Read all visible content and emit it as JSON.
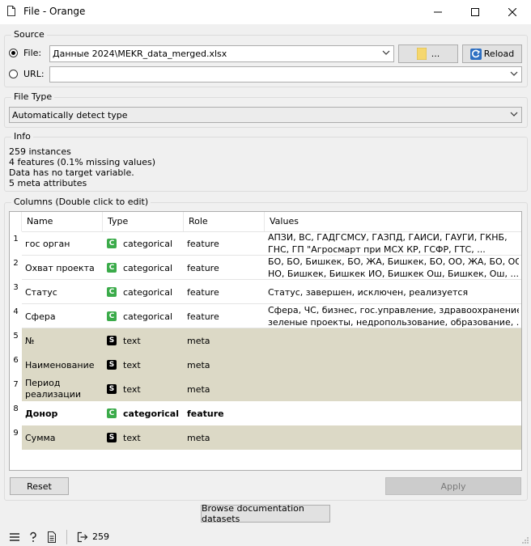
{
  "window": {
    "title": "File - Orange"
  },
  "source": {
    "title": "Source",
    "file_label": "File:",
    "file_value": "Данные 2024\\MEKR_data_merged.xlsx",
    "browse_label": "...",
    "reload_label": "Reload",
    "url_label": "URL:",
    "url_value": "",
    "selected": "file"
  },
  "file_type": {
    "title": "File Type",
    "value": "Automatically detect type"
  },
  "info": {
    "title": "Info",
    "lines": [
      "259 instances",
      "4 features (0.1% missing values)",
      "Data has no target variable.",
      "5 meta attributes"
    ]
  },
  "columns": {
    "title": "Columns (Double click to edit)",
    "headers": [
      "Name",
      "Type",
      "Role",
      "Values"
    ],
    "rows": [
      {
        "num": "1",
        "name": "гос орган",
        "type": "categorical",
        "badge": "C",
        "role": "feature",
        "values": [
          "АПЗИ, ВС, ГАДГСМСУ, ГАЗПД, ГАИСИ, ГАУГИ, ГКНБ,",
          "ГНС, ГП \"Агросмарт при МСХ КР, ГСФР, ГТС, ..."
        ]
      },
      {
        "num": "2",
        "name": "Охват проекта",
        "type": "categorical",
        "badge": "C",
        "role": "feature",
        "values": [
          "БО, БО, Бишкек, БО, ЖА, Бишкек, БО, ОО, ЖА, БО, ОО,",
          "НО, Бишкек, Бишкек ИО, Бишкек Ош, Бишкек, Ош, ..."
        ]
      },
      {
        "num": "3",
        "name": "Статус",
        "type": "categorical",
        "badge": "C",
        "role": "feature",
        "values": [
          "Статус, завершен, исключен, реализуется"
        ]
      },
      {
        "num": "4",
        "name": "Сфера",
        "type": "categorical",
        "badge": "C",
        "role": "feature",
        "values": [
          "Сфера, ЧС, бизнес, гос.управление, здравоохранение,",
          "зеленые проекты, недропользование, образование, ..."
        ]
      },
      {
        "num": "5",
        "name": "№",
        "type": "text",
        "badge": "S",
        "role": "meta",
        "values": []
      },
      {
        "num": "6",
        "name": "Наименование",
        "type": "text",
        "badge": "S",
        "role": "meta",
        "values": []
      },
      {
        "num": "7",
        "name": "Период реализации",
        "type": "text",
        "badge": "S",
        "role": "meta",
        "values": []
      },
      {
        "num": "8",
        "name": "Донор",
        "type": "categorical",
        "badge": "C",
        "role": "feature",
        "values": []
      },
      {
        "num": "9",
        "name": "Сумма",
        "type": "text",
        "badge": "S",
        "role": "meta",
        "values": []
      }
    ]
  },
  "buttons": {
    "reset": "Reset",
    "apply": "Apply",
    "browse_docs": "Browse documentation datasets"
  },
  "status_bar": {
    "output_count": "259"
  },
  "colors": {
    "meta_row": "#dcd9c6",
    "categorical_badge": "#3bab4a",
    "text_badge": "#000000"
  }
}
